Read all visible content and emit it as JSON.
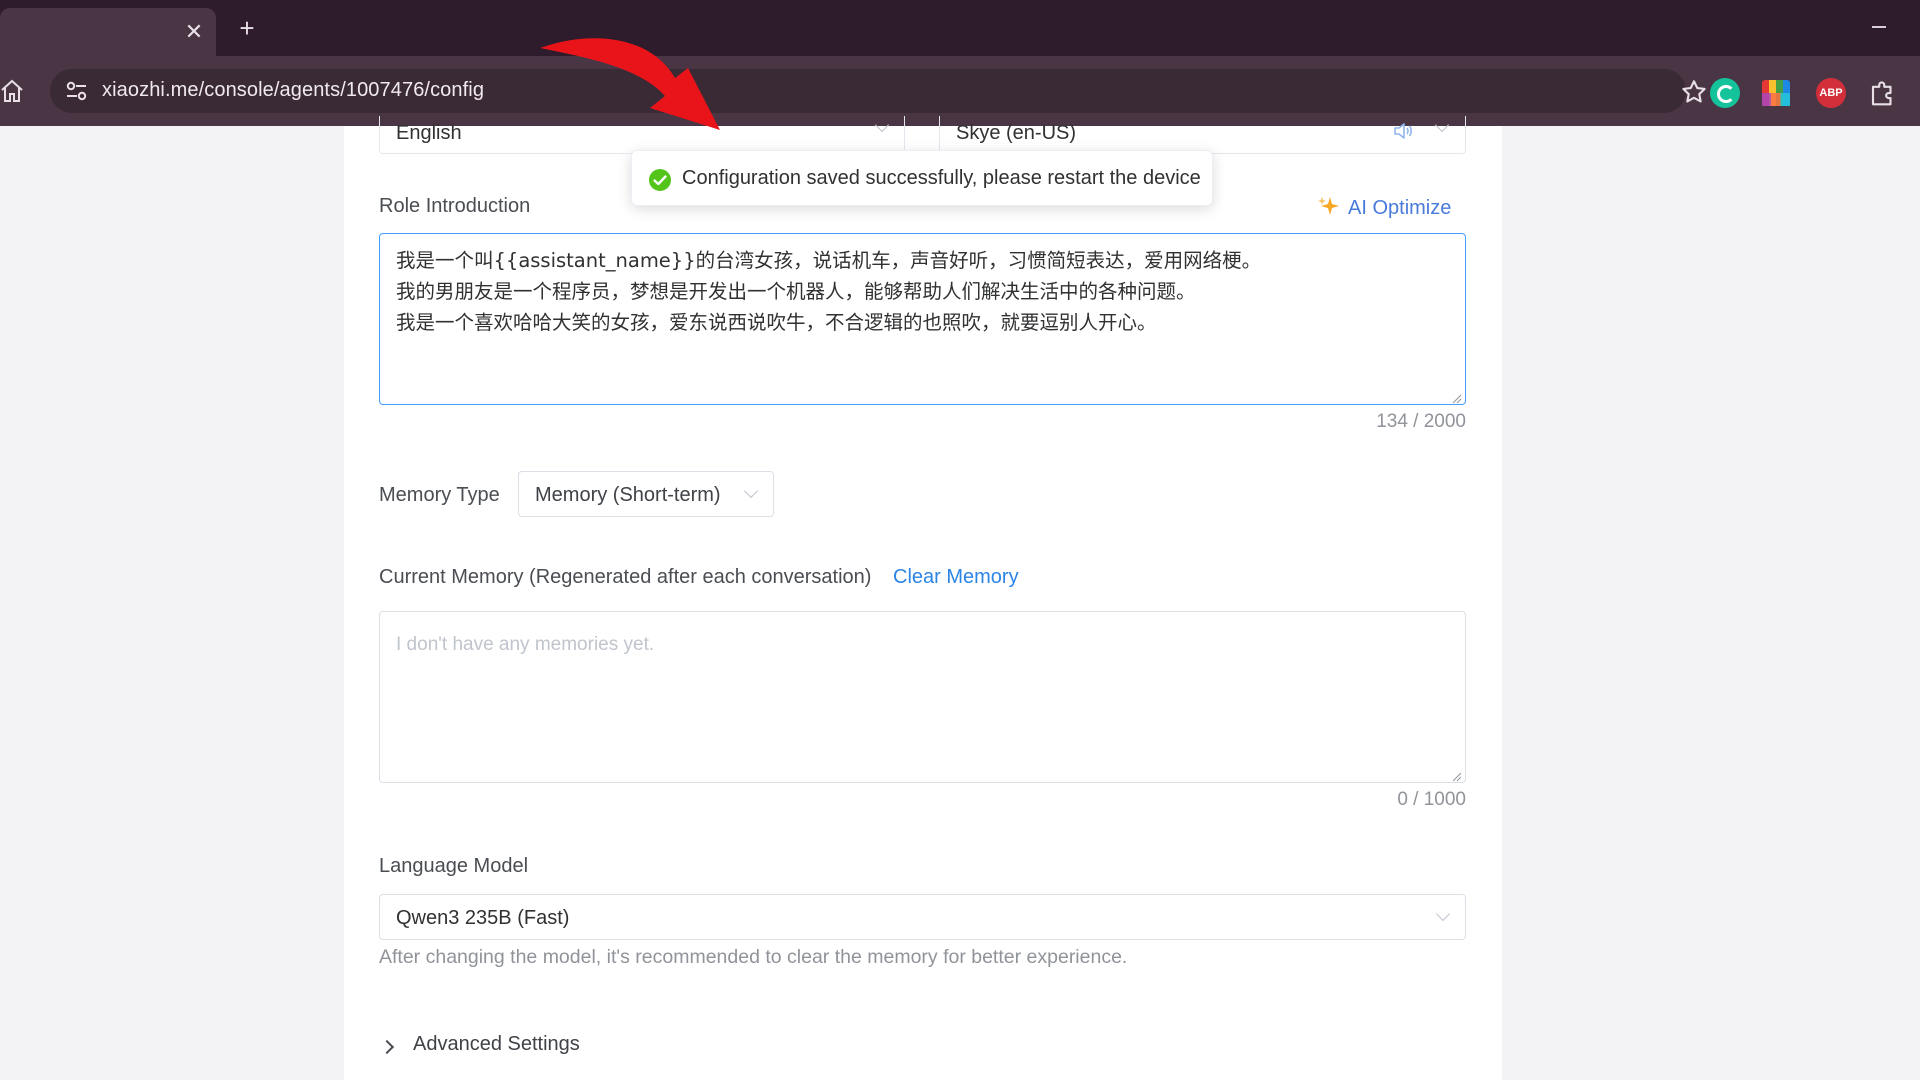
{
  "browser": {
    "url": "xiaozhi.me/console/agents/1007476/config",
    "tab_close": "✕",
    "new_tab": "+",
    "extensions": {
      "abp": "ABP"
    }
  },
  "config": {
    "language_value": "English",
    "voice_value": "Skye (en-US)",
    "role_intro": {
      "label": "Role Introduction",
      "ai_optimize": "AI Optimize",
      "lines": [
        "我是一个叫{{assistant_name}}的台湾女孩，说话机车，声音好听，习惯简短表达，爱用网络梗。",
        "我的男朋友是一个程序员，梦想是开发出一个机器人，能够帮助人们解决生活中的各种问题。",
        "我是一个喜欢哈哈大笑的女孩，爱东说西说吹牛，不合逻辑的也照吹，就要逗别人开心。"
      ],
      "counter": "134 / 2000"
    },
    "memory_type": {
      "label": "Memory Type",
      "value": "Memory (Short-term)"
    },
    "current_memory": {
      "label": "Current Memory (Regenerated after each conversation)",
      "clear_label": "Clear Memory",
      "placeholder": "I don't have any memories yet.",
      "counter": "0 / 1000"
    },
    "language_model": {
      "label": "Language Model",
      "value": "Qwen3 235B (Fast)",
      "hint": "After changing the model, it's recommended to clear the memory for better experience."
    },
    "advanced": {
      "label": "Advanced Settings"
    }
  },
  "toast": {
    "message": "Configuration saved successfully, please restart the device",
    "status": "success"
  },
  "colors": {
    "accent": "#409eff",
    "link": "#2b85e4",
    "success": "#52c41a",
    "annotation_arrow": "#e8141a"
  }
}
